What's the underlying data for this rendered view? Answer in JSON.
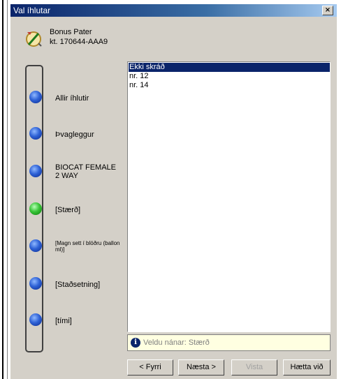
{
  "window": {
    "title": "Val íhlutar",
    "close_label": "×"
  },
  "patient": {
    "name": "Bonus Pater",
    "kt": "kt. 170644-AAA9"
  },
  "steps": [
    {
      "label": "Allir íhlutir",
      "state": "done"
    },
    {
      "label": "Þvagleggur",
      "state": "done"
    },
    {
      "label": "BIOCAT FEMALE 2 WAY",
      "state": "done"
    },
    {
      "label": "[Stærð]",
      "state": "current"
    },
    {
      "label": "[Magn sett í blöðru (ballon ml)]",
      "state": "pending"
    },
    {
      "label": "[Staðsetning]",
      "state": "pending"
    },
    {
      "label": "[tími]",
      "state": "pending"
    }
  ],
  "options": {
    "items": [
      "Ekki skráð",
      "nr. 12",
      "nr. 14"
    ],
    "selected": "Ekki skráð"
  },
  "info": {
    "icon": "info-icon",
    "text": "Veldu nánar: Stærð"
  },
  "buttons": {
    "back": {
      "label": "< Fyrri",
      "enabled": true
    },
    "next": {
      "label": "Næsta >",
      "enabled": true
    },
    "save": {
      "label": "Vista",
      "enabled": false
    },
    "cancel": {
      "label": "Hætta við",
      "enabled": true
    }
  },
  "colors": {
    "titlebar": "#0a246a",
    "selection": "#0a246a",
    "step_done": "#2f62d6",
    "step_current": "#38c438",
    "info_bg": "#ffffe1"
  }
}
